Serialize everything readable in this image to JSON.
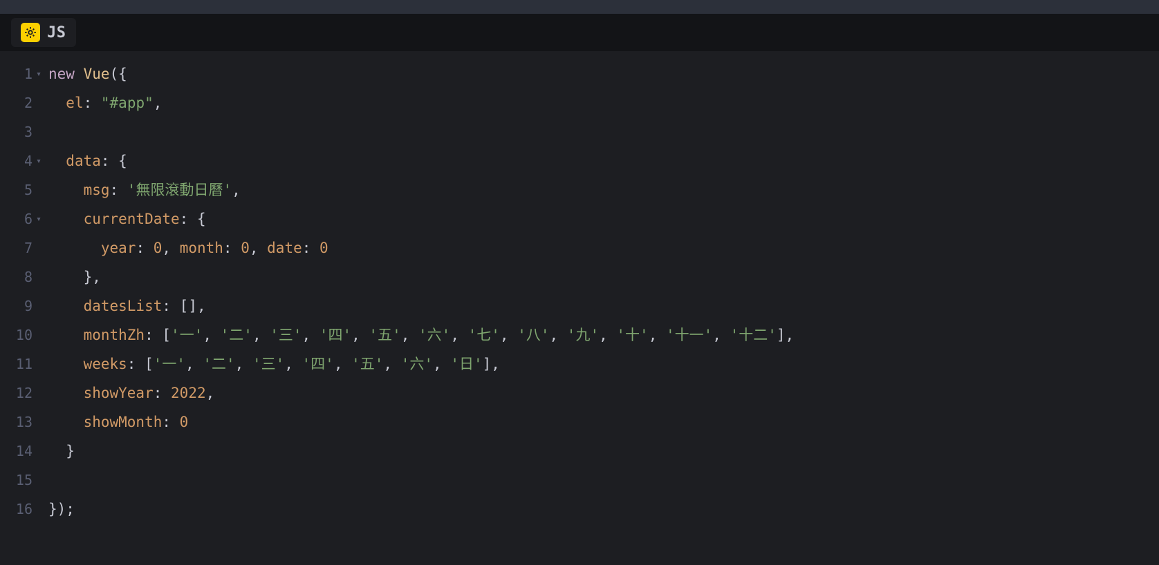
{
  "tab": {
    "label": "JS"
  },
  "gutter": {
    "lines": [
      {
        "n": "1",
        "fold": true
      },
      {
        "n": "2",
        "fold": false
      },
      {
        "n": "3",
        "fold": false
      },
      {
        "n": "4",
        "fold": true
      },
      {
        "n": "5",
        "fold": false
      },
      {
        "n": "6",
        "fold": true
      },
      {
        "n": "7",
        "fold": false
      },
      {
        "n": "8",
        "fold": false
      },
      {
        "n": "9",
        "fold": false
      },
      {
        "n": "10",
        "fold": false
      },
      {
        "n": "11",
        "fold": false
      },
      {
        "n": "12",
        "fold": false
      },
      {
        "n": "13",
        "fold": false
      },
      {
        "n": "14",
        "fold": false
      },
      {
        "n": "15",
        "fold": false
      },
      {
        "n": "16",
        "fold": false
      }
    ]
  },
  "code": {
    "l1": {
      "kw": "new",
      "sp": " ",
      "cls": "Vue",
      "rest": "({"
    },
    "l2": {
      "indent": "  ",
      "key": "el",
      "colon": ": ",
      "str": "\"#app\"",
      "comma": ","
    },
    "l3": {
      "blank": " "
    },
    "l4": {
      "indent": "  ",
      "key": "data",
      "colon": ": ",
      "brace": "{"
    },
    "l5": {
      "indent": "    ",
      "key": "msg",
      "colon": ": ",
      "str": "'無限滾動日曆'",
      "comma": ","
    },
    "l6": {
      "indent": "    ",
      "key": "currentDate",
      "colon": ": ",
      "brace": "{"
    },
    "l7": {
      "indent": "      ",
      "k1": "year",
      "c1": ": ",
      "n1": "0",
      "s1": ", ",
      "k2": "month",
      "c2": ": ",
      "n2": "0",
      "s2": ", ",
      "k3": "date",
      "c3": ": ",
      "n3": "0"
    },
    "l8": {
      "indent": "    ",
      "close": "},"
    },
    "l9": {
      "indent": "    ",
      "key": "datesList",
      "colon": ": ",
      "val": "[],"
    },
    "l10": {
      "indent": "    ",
      "key": "monthZh",
      "colon": ": ",
      "open": "[",
      "items": [
        "'一'",
        "'二'",
        "'三'",
        "'四'",
        "'五'",
        "'六'",
        "'七'",
        "'八'",
        "'九'",
        "'十'",
        "'十一'",
        "'十二'"
      ],
      "close": "],"
    },
    "l11": {
      "indent": "    ",
      "key": "weeks",
      "colon": ": ",
      "open": "[",
      "items": [
        "'一'",
        "'二'",
        "'三'",
        "'四'",
        "'五'",
        "'六'",
        "'日'"
      ],
      "close": "],"
    },
    "l12": {
      "indent": "    ",
      "key": "showYear",
      "colon": ": ",
      "num": "2022",
      "comma": ","
    },
    "l13": {
      "indent": "    ",
      "key": "showMonth",
      "colon": ": ",
      "num": "0"
    },
    "l14": {
      "indent": "  ",
      "close": "}"
    },
    "l15": {
      "blank": " "
    },
    "l16": {
      "indent": "",
      "close": "});"
    }
  }
}
